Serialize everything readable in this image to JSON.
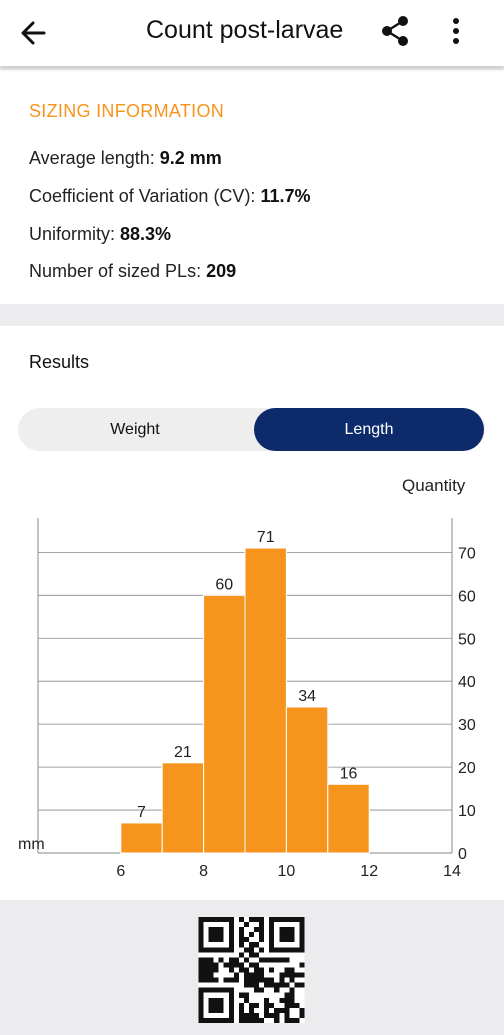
{
  "appbar": {
    "title": "Count post-larvae",
    "back_icon": "arrow-left-icon",
    "share_icon": "share-icon",
    "more_icon": "more-vert-icon"
  },
  "sizing": {
    "heading": "SIZING INFORMATION",
    "avg_label": "Average length: ",
    "avg_value": "9.2 mm",
    "cv_label": "Coefficient of Variation (CV): ",
    "cv_value": "11.7%",
    "uniformity_label": "Uniformity: ",
    "uniformity_value": "88.3%",
    "count_label": "Number of sized PLs: ",
    "count_value": "209"
  },
  "results": {
    "heading": "Results",
    "toggle": {
      "weight_label": "Weight",
      "length_label": "Length",
      "selected": "Length"
    }
  },
  "colors": {
    "bar": "#f7941d",
    "toggle_active": "#0d2a6b",
    "accent": "#f7941d"
  },
  "chart_data": {
    "type": "bar",
    "xlabel": "mm",
    "ylabel": "Quantity",
    "bins": [
      6,
      7,
      8,
      9,
      10,
      11
    ],
    "bin_width": 1,
    "values": [
      7,
      21,
      60,
      71,
      34,
      16
    ],
    "xlim": [
      4,
      14
    ],
    "xticks": [
      6,
      8,
      10,
      12,
      14
    ],
    "ylim": [
      0,
      78
    ],
    "yticks": [
      0,
      10,
      20,
      30,
      40,
      50,
      60,
      70
    ],
    "data_labels": true,
    "grid": "horizontal",
    "y_axis_position": "right"
  }
}
